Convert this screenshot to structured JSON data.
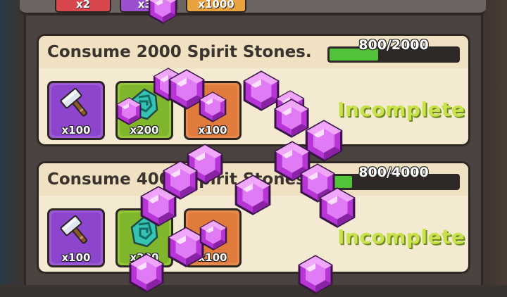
{
  "top_chips": [
    {
      "label": "x2",
      "color": "#d9474e"
    },
    {
      "label": "x30",
      "color": "#9b4fd1"
    },
    {
      "label": "x1000",
      "color": "#e8a23e"
    }
  ],
  "tasks": [
    {
      "title": "Consume 2000 Spirit Stones.",
      "progress_text": "800/2000",
      "progress": 0.4,
      "status": "Incomplete",
      "rewards": [
        {
          "icon": "hammer-icon",
          "qty": "x100",
          "color": "purple"
        },
        {
          "icon": "rune-stone-icon",
          "qty": "x200",
          "color": "green"
        },
        {
          "icon": "gem-icon",
          "qty": "x100",
          "color": "orange"
        }
      ]
    },
    {
      "title": "Consume 4000 Spirit Stones.",
      "progress_text": "800/4000",
      "progress": 0.2,
      "status": "Incomplete",
      "rewards": [
        {
          "icon": "hammer-icon",
          "qty": "x100",
          "color": "purple"
        },
        {
          "icon": "rune-stone-icon",
          "qty": "x200",
          "color": "green"
        },
        {
          "icon": "gem-icon",
          "qty": "x100",
          "color": "orange"
        }
      ]
    }
  ],
  "colors": {
    "progress_fill": "#52c23a",
    "status_text": "#c9e24b",
    "gem_purple": "#c23fe0"
  }
}
